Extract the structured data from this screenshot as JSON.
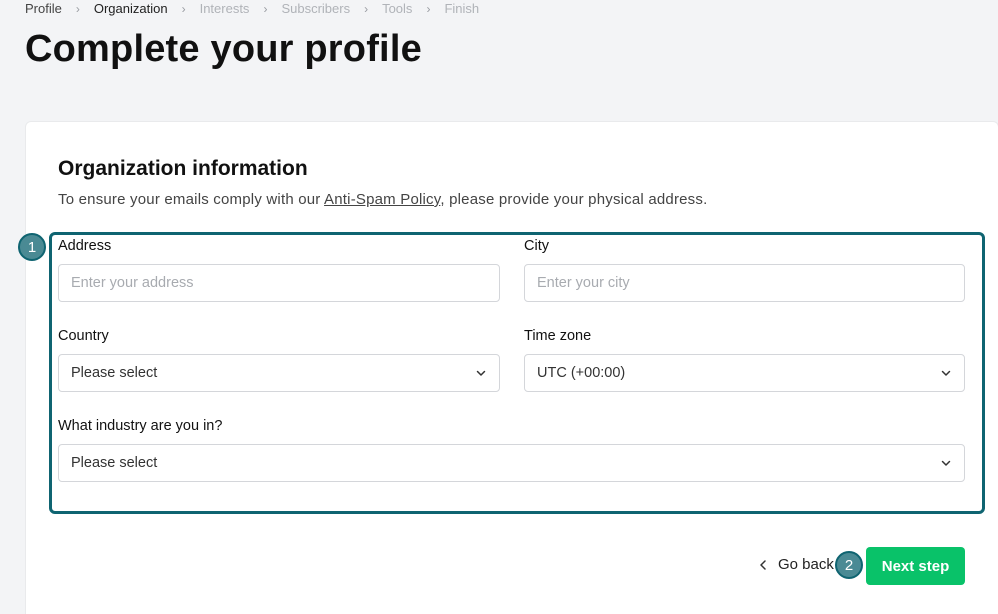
{
  "breadcrumb": [
    {
      "label": "Profile",
      "state": "done"
    },
    {
      "label": "Organization",
      "state": "active"
    },
    {
      "label": "Interests",
      "state": "todo"
    },
    {
      "label": "Subscribers",
      "state": "todo"
    },
    {
      "label": "Tools",
      "state": "todo"
    },
    {
      "label": "Finish",
      "state": "todo"
    }
  ],
  "page_title": "Complete your profile",
  "section": {
    "title": "Organization information",
    "desc_before": "To ensure your emails comply with our ",
    "desc_link": "Anti-Spam Policy",
    "desc_after": ", please provide your physical address."
  },
  "form": {
    "address": {
      "label": "Address",
      "placeholder": "Enter your address",
      "value": ""
    },
    "city": {
      "label": "City",
      "placeholder": "Enter your city",
      "value": ""
    },
    "country": {
      "label": "Country",
      "value": "Please select"
    },
    "timezone": {
      "label": "Time zone",
      "value": "UTC (+00:00)"
    },
    "industry": {
      "label": "What industry are you in?",
      "value": "Please select"
    }
  },
  "badges": {
    "one": "1",
    "two": "2"
  },
  "actions": {
    "go_back": "Go back",
    "next_step": "Next step"
  },
  "colors": {
    "accent": "#09c269",
    "highlight": "#0f6471",
    "badge": "#4a8a94",
    "background": "#f3f4f6"
  },
  "icons": {
    "separator": "chevron-right-icon",
    "select": "chevron-down-icon",
    "back": "chevron-left-icon"
  }
}
